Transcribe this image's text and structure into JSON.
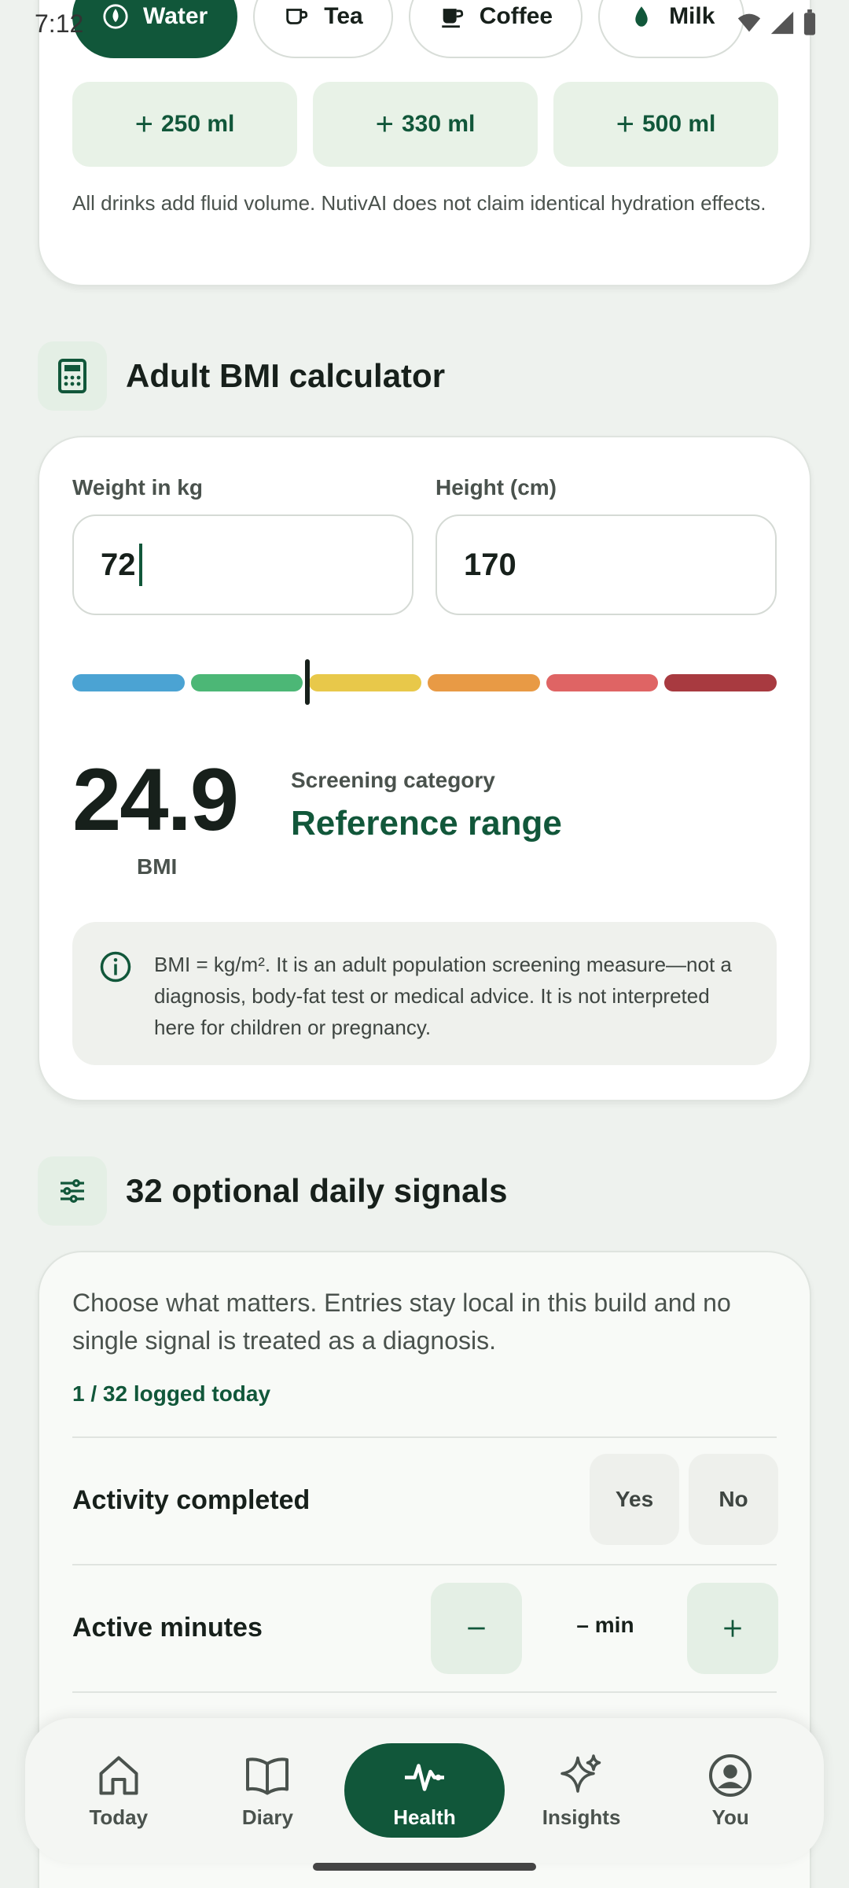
{
  "status_bar": {
    "time": "7:12"
  },
  "drinks": {
    "chips": [
      {
        "label": "Water",
        "active": true
      },
      {
        "label": "Tea",
        "active": false
      },
      {
        "label": "Coffee",
        "active": false
      },
      {
        "label": "Milk",
        "active": false
      }
    ],
    "amounts": [
      "250 ml",
      "330 ml",
      "500 ml"
    ],
    "note": "All drinks add fluid volume. NutivAI does not claim identical hydration effects."
  },
  "bmi": {
    "title": "Adult BMI calculator",
    "weight_label": "Weight in kg",
    "weight_value": "72",
    "height_label": "Height (cm)",
    "height_value": "170",
    "scale_colors": [
      "#4ba3d3",
      "#4cb776",
      "#e8c84a",
      "#e89a45",
      "#df6464",
      "#a83a40"
    ],
    "value": "24.9",
    "unit": "BMI",
    "category_label": "Screening category",
    "category_value": "Reference range",
    "info": "BMI = kg/m². It is an adult population screening measure—not a diagnosis, body-fat test or medical advice. It is not interpreted here for children or pregnancy."
  },
  "signals": {
    "title": "32 optional daily signals",
    "intro": "Choose what matters. Entries stay local in this build and no single signal is treated as a diagnosis.",
    "count": "1 / 32 logged today",
    "rows": {
      "activity_label": "Activity completed",
      "yes": "Yes",
      "no": "No",
      "minutes_label": "Active minutes",
      "minutes_value": "– min"
    }
  },
  "nav": {
    "items": [
      {
        "label": "Today",
        "icon": "home-icon"
      },
      {
        "label": "Diary",
        "icon": "book-icon"
      },
      {
        "label": "Health",
        "icon": "pulse-icon",
        "active": true
      },
      {
        "label": "Insights",
        "icon": "sparkle-icon"
      },
      {
        "label": "You",
        "icon": "person-icon"
      }
    ]
  },
  "colors": {
    "primary": "#11573a",
    "accent_bg": "#e4efe5"
  }
}
